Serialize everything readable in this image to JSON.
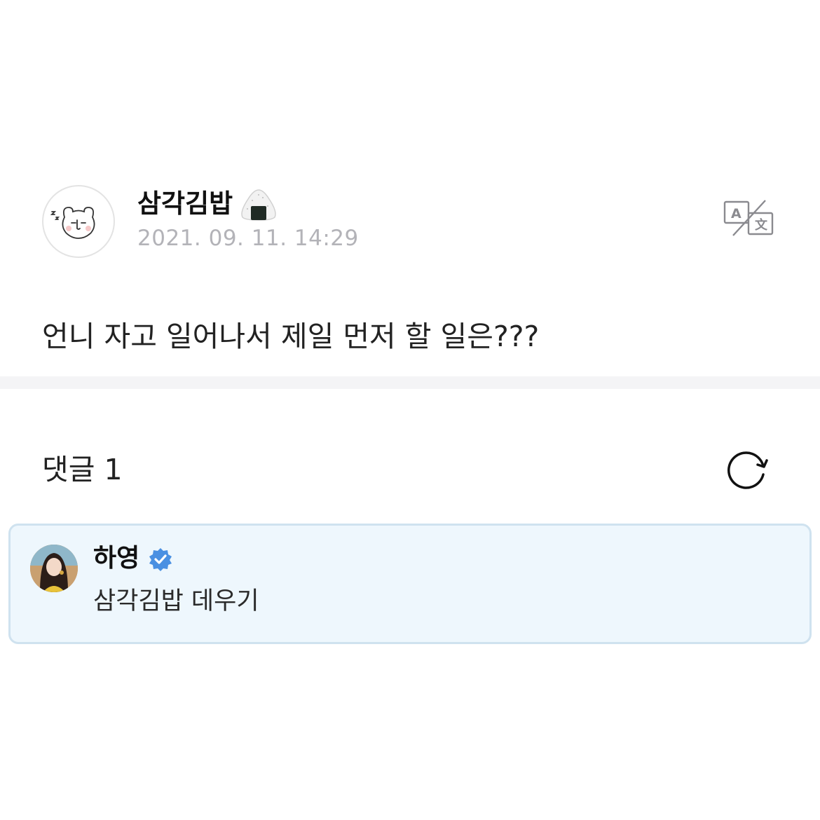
{
  "post": {
    "author": "삼각김밥",
    "author_emoji_icon": "onigiri-icon",
    "date": "2021. 09. 11. 14:29",
    "body": "언니 자고 일어나서 제일 먼저 할 일은???",
    "translate_icon": "translate-icon"
  },
  "comments": {
    "title": "댓글 1",
    "refresh_icon": "refresh-icon",
    "items": [
      {
        "author": "하영",
        "verified_icon": "verified-badge-icon",
        "text": "삼각김밥 데우기"
      }
    ]
  },
  "colors": {
    "date_gray": "#b3b3b8",
    "divider": "#f4f4f6",
    "comment_bg": "#eef7fd",
    "comment_border": "#cfe2ef",
    "verified_blue": "#4a90e2"
  }
}
